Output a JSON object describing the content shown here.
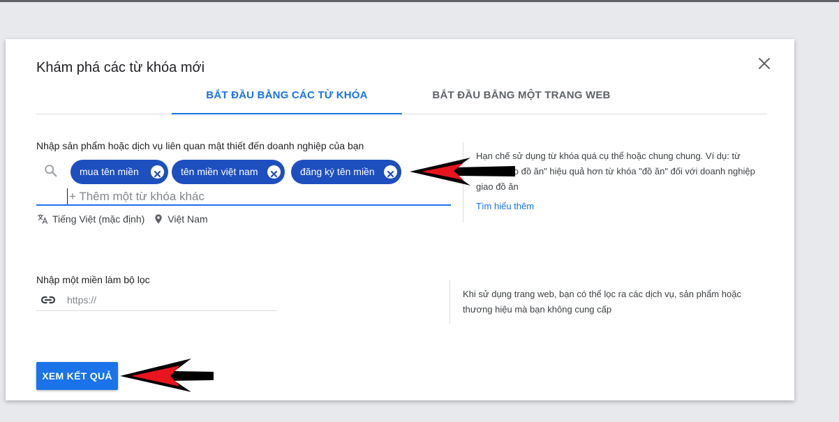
{
  "dialog": {
    "title": "Khám phá các từ khóa mới",
    "close_icon": "close-icon"
  },
  "tabs": [
    {
      "label": "BẮT ĐẦU BẰNG CÁC TỪ KHÓA",
      "active": true
    },
    {
      "label": "BẮT ĐẦU BẰNG MỘT TRANG WEB",
      "active": false
    }
  ],
  "keywords_section": {
    "label": "Nhập sản phẩm hoặc dịch vụ liên quan mật thiết đến doanh nghiệp của bạn",
    "chips": [
      {
        "label": "mua tên miền"
      },
      {
        "label": "tên miền việt nam"
      },
      {
        "label": "đăng ký tên miền"
      }
    ],
    "input_placeholder": "+ Thêm một từ khóa khác",
    "language": "Tiếng Việt (mặc định)",
    "location": "Việt Nam",
    "hint": "Hạn chế sử dụng từ khóa quá cụ thể hoặc chung chung. Ví dụ: từ khóa \"giao đồ ăn\" hiệu quả hơn từ khóa \"đồ ăn\" đối với doanh nghiệp giao đồ ăn",
    "learn_more": "Tìm hiểu thêm"
  },
  "domain_section": {
    "label": "Nhập một miền làm bộ lọc",
    "input_placeholder": "https://",
    "hint": "Khi sử dụng trang web, bạn có thể lọc ra các dịch vụ, sản phẩm hoặc thương hiệu mà bạn không cung cấp"
  },
  "actions": {
    "results_label": "XEM KẾT QUẢ"
  },
  "colors": {
    "accent": "#1a73e8",
    "chip": "#1e4fbf",
    "annotation_arrow": "#000000",
    "annotation_arrow_fill": "#e8141e"
  }
}
